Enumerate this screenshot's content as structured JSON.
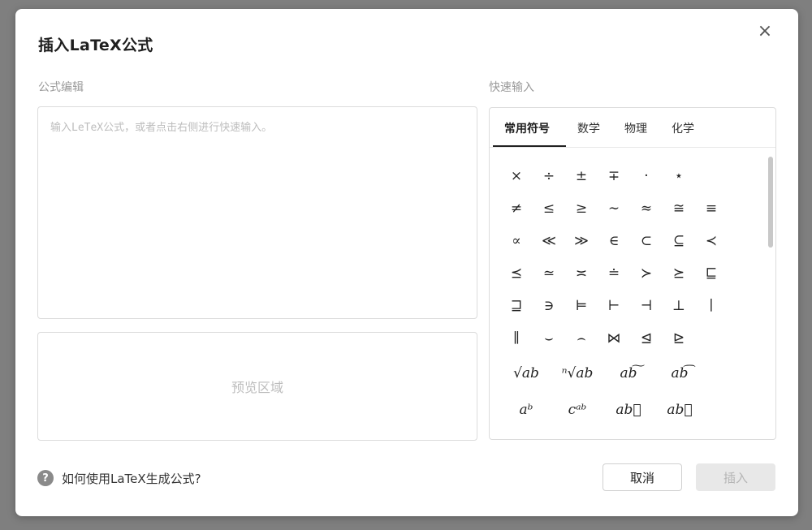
{
  "dialog": {
    "title": "插入LaTeX公式",
    "close_label": "×"
  },
  "editor": {
    "label": "公式编辑",
    "value": "",
    "placeholder": "输入LeTeX公式，或者点击右侧进行快速输入。"
  },
  "preview": {
    "placeholder": "预览区域"
  },
  "quick_input": {
    "label": "快速输入",
    "tabs": [
      {
        "label": "常用符号",
        "active": true
      },
      {
        "label": "数学",
        "active": false
      },
      {
        "label": "物理",
        "active": false
      },
      {
        "label": "化学",
        "active": false
      }
    ],
    "symbols": [
      [
        "×",
        "÷",
        "±",
        "∓",
        "·",
        "⋆"
      ],
      [
        "≠",
        "≤",
        "≥",
        "∼",
        "≈",
        "≅",
        "≡"
      ],
      [
        "∝",
        "≪",
        "≫",
        "∈",
        "⊂",
        "⊆",
        "≺"
      ],
      [
        "⪯",
        "≃",
        "≍",
        "≐",
        "≻",
        "⪰",
        "⊑"
      ],
      [
        "⊒",
        "∋",
        "⊨",
        "⊢",
        "⊣",
        "⊥",
        "∣"
      ],
      [
        "∥",
        "⌣",
        "⌢",
        "⋈",
        "⊴",
        "⊵"
      ],
      [
        "√ab",
        "ⁿ√ab",
        "ab͠",
        "ab͡"
      ],
      [
        "aᵇ",
        "cᵃᵇ",
        "ab⃖",
        "ab⃗"
      ]
    ]
  },
  "footer": {
    "help_icon": "?",
    "help_text": "如何使用LaTeX生成公式?",
    "cancel_label": "取消",
    "insert_label": "插入"
  }
}
